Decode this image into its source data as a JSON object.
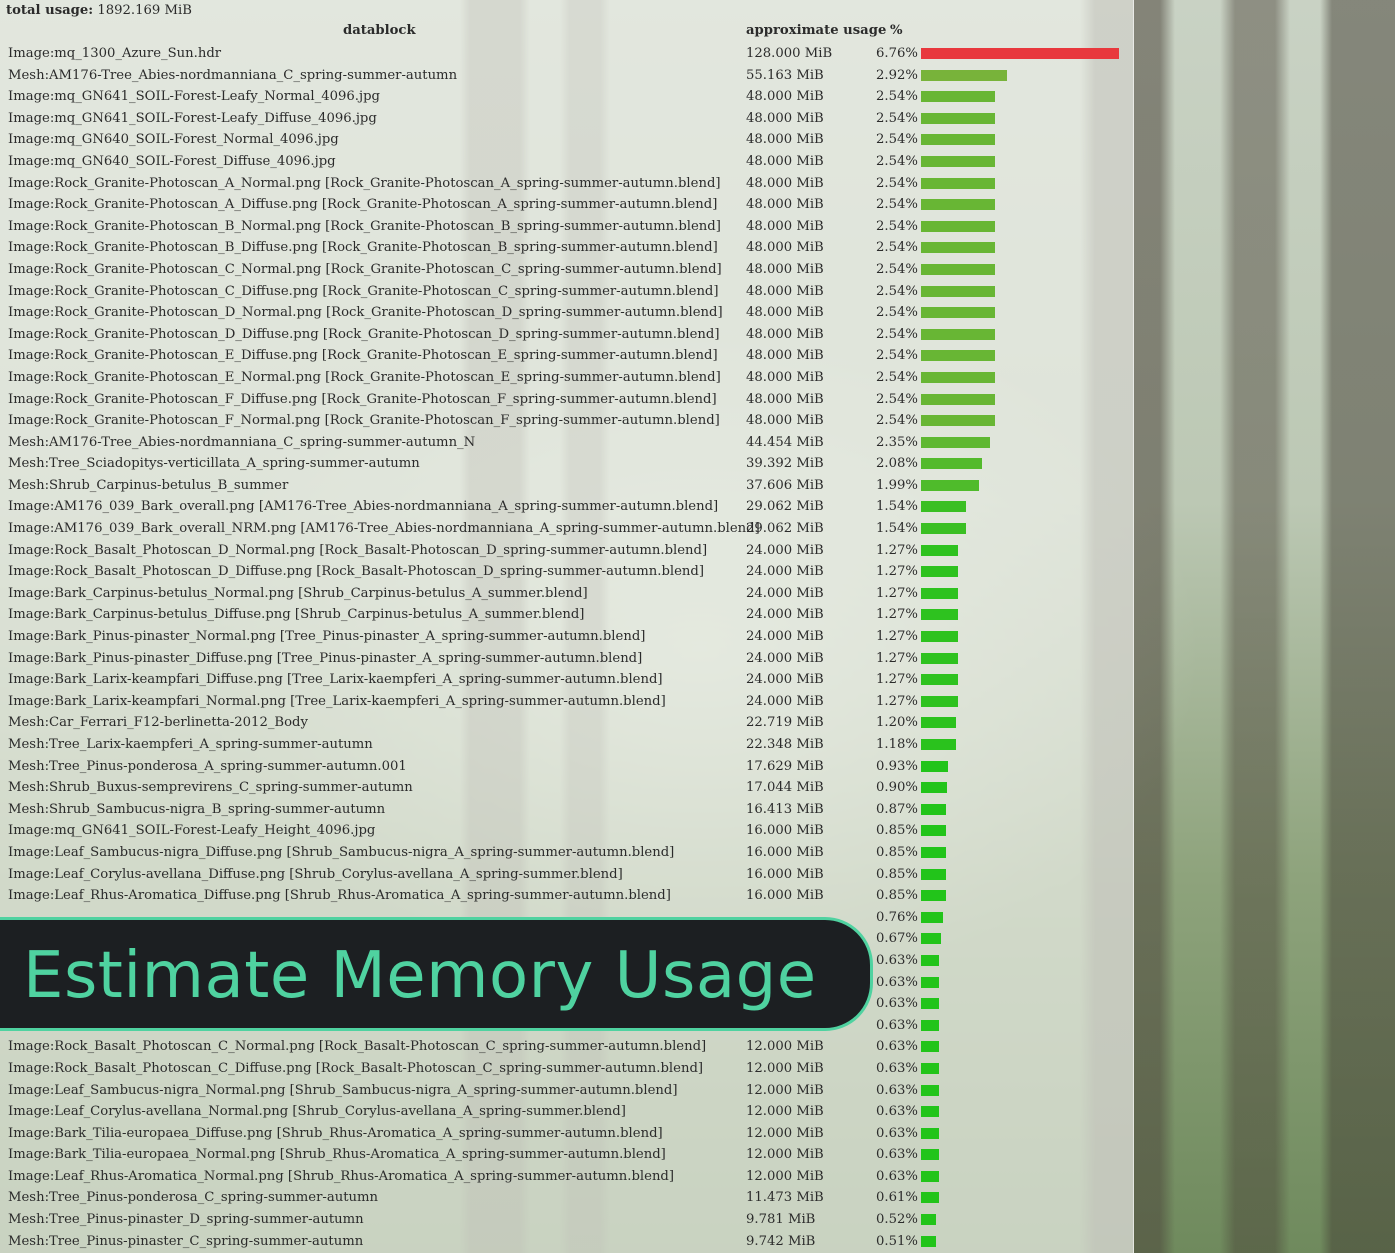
{
  "header": {
    "total_label": "total usage:",
    "total_value": "1892.169 MiB",
    "col_datablock": "datablock",
    "col_usage": "approximate usage",
    "col_percent": "%"
  },
  "badge": {
    "title": "Estimate Memory Usage"
  },
  "colors": {
    "bar_high": "#e8383d",
    "bar_mid": "#78b33a",
    "bar_low": "#22c41a",
    "accent": "#4fd2a0"
  },
  "rows": [
    {
      "name": "Image:mq_1300_Azure_Sun.hdr",
      "usage": "128.000 MiB",
      "percent": "6.76%",
      "fraction": 6.76
    },
    {
      "name": "Mesh:AM176-Tree_Abies-nordmanniana_C_spring-summer-autumn",
      "usage": "55.163 MiB",
      "percent": "2.92%",
      "fraction": 2.92
    },
    {
      "name": "Image:mq_GN641_SOIL-Forest-Leafy_Normal_4096.jpg",
      "usage": "48.000 MiB",
      "percent": "2.54%",
      "fraction": 2.54
    },
    {
      "name": "Image:mq_GN641_SOIL-Forest-Leafy_Diffuse_4096.jpg",
      "usage": "48.000 MiB",
      "percent": "2.54%",
      "fraction": 2.54
    },
    {
      "name": "Image:mq_GN640_SOIL-Forest_Normal_4096.jpg",
      "usage": "48.000 MiB",
      "percent": "2.54%",
      "fraction": 2.54
    },
    {
      "name": "Image:mq_GN640_SOIL-Forest_Diffuse_4096.jpg",
      "usage": "48.000 MiB",
      "percent": "2.54%",
      "fraction": 2.54
    },
    {
      "name": "Image:Rock_Granite-Photoscan_A_Normal.png [Rock_Granite-Photoscan_A_spring-summer-autumn.blend]",
      "usage": "48.000 MiB",
      "percent": "2.54%",
      "fraction": 2.54
    },
    {
      "name": "Image:Rock_Granite-Photoscan_A_Diffuse.png [Rock_Granite-Photoscan_A_spring-summer-autumn.blend]",
      "usage": "48.000 MiB",
      "percent": "2.54%",
      "fraction": 2.54
    },
    {
      "name": "Image:Rock_Granite-Photoscan_B_Normal.png [Rock_Granite-Photoscan_B_spring-summer-autumn.blend]",
      "usage": "48.000 MiB",
      "percent": "2.54%",
      "fraction": 2.54
    },
    {
      "name": "Image:Rock_Granite-Photoscan_B_Diffuse.png [Rock_Granite-Photoscan_B_spring-summer-autumn.blend]",
      "usage": "48.000 MiB",
      "percent": "2.54%",
      "fraction": 2.54
    },
    {
      "name": "Image:Rock_Granite-Photoscan_C_Normal.png [Rock_Granite-Photoscan_C_spring-summer-autumn.blend]",
      "usage": "48.000 MiB",
      "percent": "2.54%",
      "fraction": 2.54
    },
    {
      "name": "Image:Rock_Granite-Photoscan_C_Diffuse.png [Rock_Granite-Photoscan_C_spring-summer-autumn.blend]",
      "usage": "48.000 MiB",
      "percent": "2.54%",
      "fraction": 2.54
    },
    {
      "name": "Image:Rock_Granite-Photoscan_D_Normal.png [Rock_Granite-Photoscan_D_spring-summer-autumn.blend]",
      "usage": "48.000 MiB",
      "percent": "2.54%",
      "fraction": 2.54
    },
    {
      "name": "Image:Rock_Granite-Photoscan_D_Diffuse.png [Rock_Granite-Photoscan_D_spring-summer-autumn.blend]",
      "usage": "48.000 MiB",
      "percent": "2.54%",
      "fraction": 2.54
    },
    {
      "name": "Image:Rock_Granite-Photoscan_E_Diffuse.png [Rock_Granite-Photoscan_E_spring-summer-autumn.blend]",
      "usage": "48.000 MiB",
      "percent": "2.54%",
      "fraction": 2.54
    },
    {
      "name": "Image:Rock_Granite-Photoscan_E_Normal.png [Rock_Granite-Photoscan_E_spring-summer-autumn.blend]",
      "usage": "48.000 MiB",
      "percent": "2.54%",
      "fraction": 2.54
    },
    {
      "name": "Image:Rock_Granite-Photoscan_F_Diffuse.png [Rock_Granite-Photoscan_F_spring-summer-autumn.blend]",
      "usage": "48.000 MiB",
      "percent": "2.54%",
      "fraction": 2.54
    },
    {
      "name": "Image:Rock_Granite-Photoscan_F_Normal.png [Rock_Granite-Photoscan_F_spring-summer-autumn.blend]",
      "usage": "48.000 MiB",
      "percent": "2.54%",
      "fraction": 2.54
    },
    {
      "name": "Mesh:AM176-Tree_Abies-nordmanniana_C_spring-summer-autumn_N",
      "usage": "44.454 MiB",
      "percent": "2.35%",
      "fraction": 2.35
    },
    {
      "name": "Mesh:Tree_Sciadopitys-verticillata_A_spring-summer-autumn",
      "usage": "39.392 MiB",
      "percent": "2.08%",
      "fraction": 2.08
    },
    {
      "name": "Mesh:Shrub_Carpinus-betulus_B_summer",
      "usage": "37.606 MiB",
      "percent": "1.99%",
      "fraction": 1.99
    },
    {
      "name": "Image:AM176_039_Bark_overall.png [AM176-Tree_Abies-nordmanniana_A_spring-summer-autumn.blend]",
      "usage": "29.062 MiB",
      "percent": "1.54%",
      "fraction": 1.54
    },
    {
      "name": "Image:AM176_039_Bark_overall_NRM.png [AM176-Tree_Abies-nordmanniana_A_spring-summer-autumn.blend]",
      "usage": "29.062 MiB",
      "percent": "1.54%",
      "fraction": 1.54
    },
    {
      "name": "Image:Rock_Basalt_Photoscan_D_Normal.png [Rock_Basalt-Photoscan_D_spring-summer-autumn.blend]",
      "usage": "24.000 MiB",
      "percent": "1.27%",
      "fraction": 1.27
    },
    {
      "name": "Image:Rock_Basalt_Photoscan_D_Diffuse.png [Rock_Basalt-Photoscan_D_spring-summer-autumn.blend]",
      "usage": "24.000 MiB",
      "percent": "1.27%",
      "fraction": 1.27
    },
    {
      "name": "Image:Bark_Carpinus-betulus_Normal.png [Shrub_Carpinus-betulus_A_summer.blend]",
      "usage": "24.000 MiB",
      "percent": "1.27%",
      "fraction": 1.27
    },
    {
      "name": "Image:Bark_Carpinus-betulus_Diffuse.png [Shrub_Carpinus-betulus_A_summer.blend]",
      "usage": "24.000 MiB",
      "percent": "1.27%",
      "fraction": 1.27
    },
    {
      "name": "Image:Bark_Pinus-pinaster_Normal.png [Tree_Pinus-pinaster_A_spring-summer-autumn.blend]",
      "usage": "24.000 MiB",
      "percent": "1.27%",
      "fraction": 1.27
    },
    {
      "name": "Image:Bark_Pinus-pinaster_Diffuse.png [Tree_Pinus-pinaster_A_spring-summer-autumn.blend]",
      "usage": "24.000 MiB",
      "percent": "1.27%",
      "fraction": 1.27
    },
    {
      "name": "Image:Bark_Larix-keampfari_Diffuse.png [Tree_Larix-kaempferi_A_spring-summer-autumn.blend]",
      "usage": "24.000 MiB",
      "percent": "1.27%",
      "fraction": 1.27
    },
    {
      "name": "Image:Bark_Larix-keampfari_Normal.png [Tree_Larix-kaempferi_A_spring-summer-autumn.blend]",
      "usage": "24.000 MiB",
      "percent": "1.27%",
      "fraction": 1.27
    },
    {
      "name": "Mesh:Car_Ferrari_F12-berlinetta-2012_Body",
      "usage": "22.719 MiB",
      "percent": "1.20%",
      "fraction": 1.2
    },
    {
      "name": "Mesh:Tree_Larix-kaempferi_A_spring-summer-autumn",
      "usage": "22.348 MiB",
      "percent": "1.18%",
      "fraction": 1.18
    },
    {
      "name": "Mesh:Tree_Pinus-ponderosa_A_spring-summer-autumn.001",
      "usage": "17.629 MiB",
      "percent": "0.93%",
      "fraction": 0.93
    },
    {
      "name": "Mesh:Shrub_Buxus-semprevirens_C_spring-summer-autumn",
      "usage": "17.044 MiB",
      "percent": "0.90%",
      "fraction": 0.9
    },
    {
      "name": "Mesh:Shrub_Sambucus-nigra_B_spring-summer-autumn",
      "usage": "16.413 MiB",
      "percent": "0.87%",
      "fraction": 0.87
    },
    {
      "name": "Image:mq_GN641_SOIL-Forest-Leafy_Height_4096.jpg",
      "usage": "16.000 MiB",
      "percent": "0.85%",
      "fraction": 0.85
    },
    {
      "name": "Image:Leaf_Sambucus-nigra_Diffuse.png [Shrub_Sambucus-nigra_A_spring-summer-autumn.blend]",
      "usage": "16.000 MiB",
      "percent": "0.85%",
      "fraction": 0.85
    },
    {
      "name": "Image:Leaf_Corylus-avellana_Diffuse.png [Shrub_Corylus-avellana_A_spring-summer.blend]",
      "usage": "16.000 MiB",
      "percent": "0.85%",
      "fraction": 0.85
    },
    {
      "name": "Image:Leaf_Rhus-Aromatica_Diffuse.png [Shrub_Rhus-Aromatica_A_spring-summer-autumn.blend]",
      "usage": "16.000 MiB",
      "percent": "0.85%",
      "fraction": 0.85
    },
    {
      "name": "",
      "usage": "",
      "percent": "0.76%",
      "fraction": 0.76
    },
    {
      "name": "",
      "usage": "",
      "percent": "0.67%",
      "fraction": 0.67
    },
    {
      "name": "",
      "usage": "",
      "percent": "0.63%",
      "fraction": 0.63
    },
    {
      "name": "",
      "usage": "",
      "percent": "0.63%",
      "fraction": 0.63
    },
    {
      "name": "",
      "usage": "",
      "percent": "0.63%",
      "fraction": 0.63
    },
    {
      "name": "",
      "usage": "",
      "percent": "0.63%",
      "fraction": 0.63
    },
    {
      "name": "Image:Rock_Basalt_Photoscan_C_Normal.png [Rock_Basalt-Photoscan_C_spring-summer-autumn.blend]",
      "usage": "12.000 MiB",
      "percent": "0.63%",
      "fraction": 0.63
    },
    {
      "name": "Image:Rock_Basalt_Photoscan_C_Diffuse.png [Rock_Basalt-Photoscan_C_spring-summer-autumn.blend]",
      "usage": "12.000 MiB",
      "percent": "0.63%",
      "fraction": 0.63
    },
    {
      "name": "Image:Leaf_Sambucus-nigra_Normal.png [Shrub_Sambucus-nigra_A_spring-summer-autumn.blend]",
      "usage": "12.000 MiB",
      "percent": "0.63%",
      "fraction": 0.63
    },
    {
      "name": "Image:Leaf_Corylus-avellana_Normal.png [Shrub_Corylus-avellana_A_spring-summer.blend]",
      "usage": "12.000 MiB",
      "percent": "0.63%",
      "fraction": 0.63
    },
    {
      "name": "Image:Bark_Tilia-europaea_Diffuse.png [Shrub_Rhus-Aromatica_A_spring-summer-autumn.blend]",
      "usage": "12.000 MiB",
      "percent": "0.63%",
      "fraction": 0.63
    },
    {
      "name": "Image:Bark_Tilia-europaea_Normal.png [Shrub_Rhus-Aromatica_A_spring-summer-autumn.blend]",
      "usage": "12.000 MiB",
      "percent": "0.63%",
      "fraction": 0.63
    },
    {
      "name": "Image:Leaf_Rhus-Aromatica_Normal.png [Shrub_Rhus-Aromatica_A_spring-summer-autumn.blend]",
      "usage": "12.000 MiB",
      "percent": "0.63%",
      "fraction": 0.63
    },
    {
      "name": "Mesh:Tree_Pinus-ponderosa_C_spring-summer-autumn",
      "usage": "11.473 MiB",
      "percent": "0.61%",
      "fraction": 0.61
    },
    {
      "name": "Mesh:Tree_Pinus-pinaster_D_spring-summer-autumn",
      "usage": "9.781 MiB",
      "percent": "0.52%",
      "fraction": 0.52
    },
    {
      "name": "Mesh:Tree_Pinus-pinaster_C_spring-summer-autumn",
      "usage": "9.742 MiB",
      "percent": "0.51%",
      "fraction": 0.51
    }
  ]
}
